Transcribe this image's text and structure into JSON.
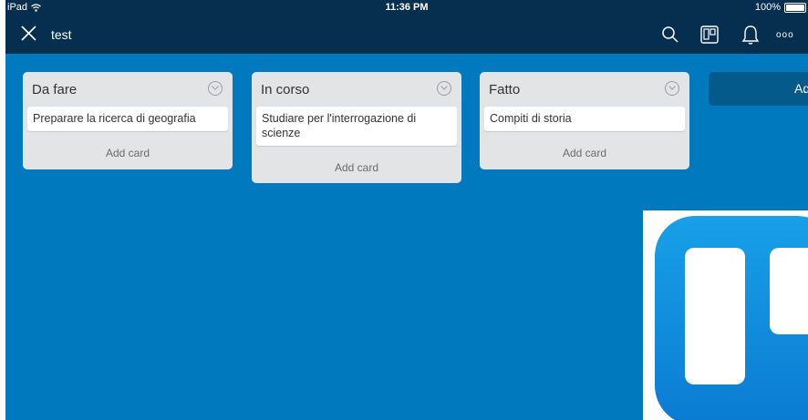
{
  "status_bar": {
    "device": "iPad",
    "time": "11:36 PM",
    "battery": "100%"
  },
  "nav": {
    "board_title": "test",
    "more_label": "ooo"
  },
  "lists": [
    {
      "title": "Da fare",
      "cards": [
        "Preparare la ricerca di geografia"
      ],
      "add_card": "Add card"
    },
    {
      "title": "In corso",
      "cards": [
        "Studiare per l'interrogazione di scienze"
      ],
      "add_card": "Add card"
    },
    {
      "title": "Fatto",
      "cards": [
        "Compiti di storia"
      ],
      "add_card": "Add card"
    }
  ],
  "add_list": {
    "label": "Ad"
  },
  "icons": [
    "wifi-icon",
    "battery-icon",
    "close-icon",
    "search-icon",
    "board-icon",
    "bell-icon",
    "more-icon",
    "chevron-down-icon",
    "trello-logo"
  ],
  "colors": {
    "board_bg": "#0079bf",
    "header_bg": "#062f4f",
    "list_bg": "#e2e4e6"
  }
}
